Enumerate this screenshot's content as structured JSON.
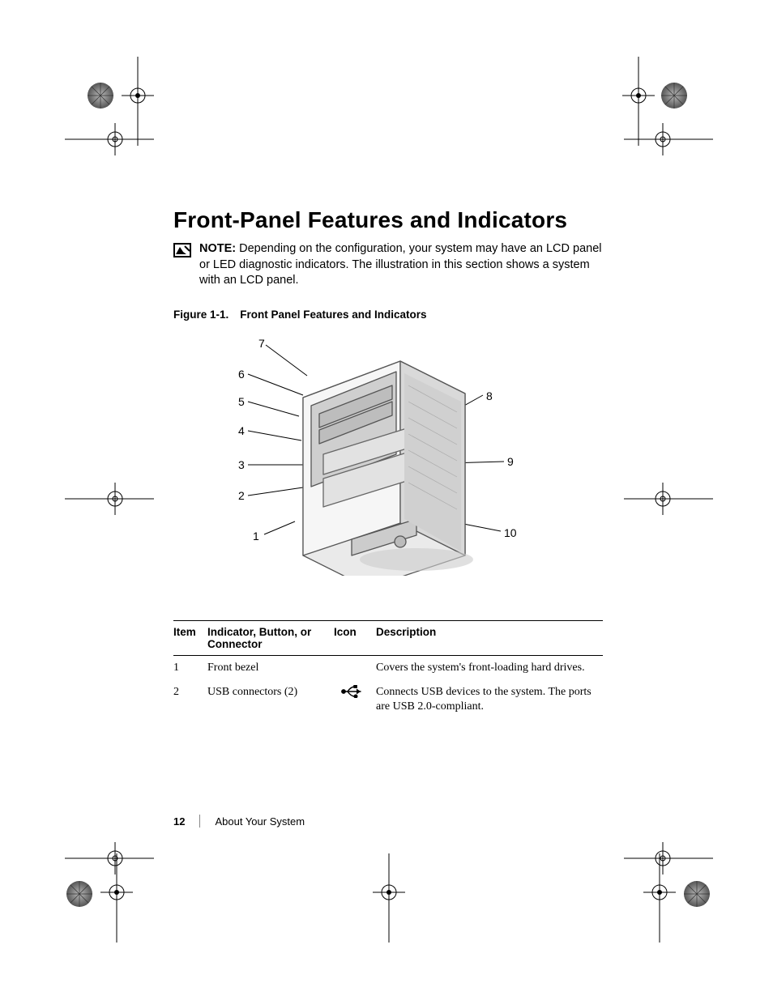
{
  "heading": "Front-Panel Features and Indicators",
  "note": {
    "label": "NOTE:",
    "text": "Depending on the configuration, your system may have an LCD panel or LED diagnostic indicators. The illustration in this section shows a system with an LCD panel."
  },
  "figure": {
    "caption_prefix": "Figure 1-1.",
    "caption_title": "Front Panel Features and Indicators",
    "callouts_left": [
      "7",
      "6",
      "5",
      "4",
      "3",
      "2",
      "1"
    ],
    "callouts_right": [
      "8",
      "9",
      "10"
    ]
  },
  "table": {
    "headers": {
      "item": "Item",
      "indicator": "Indicator, Button, or Connector",
      "icon": "Icon",
      "description": "Description"
    },
    "rows": [
      {
        "item": "1",
        "indicator": "Front bezel",
        "icon": "",
        "description": "Covers the system's front-loading hard drives."
      },
      {
        "item": "2",
        "indicator": "USB connectors (2)",
        "icon": "usb-icon",
        "description": "Connects USB devices to the system. The ports are USB 2.0-compliant."
      }
    ]
  },
  "footer": {
    "page_number": "12",
    "section": "About Your System"
  }
}
